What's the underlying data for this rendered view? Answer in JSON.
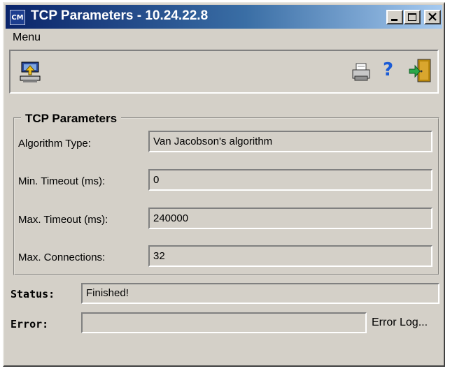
{
  "window": {
    "title": "TCP Parameters - 10.24.22.8",
    "app_icon_text": "CM",
    "controls": [
      "minimize",
      "maximize",
      "close"
    ]
  },
  "menu": {
    "items": [
      "Menu"
    ]
  },
  "toolbar": {
    "left_icon": "upload-to-device-icon",
    "right_icons": [
      "printer-icon",
      "help-icon",
      "exit-door-icon"
    ],
    "help_glyph": "?"
  },
  "tcp_parameters": {
    "group_title": "TCP Parameters",
    "fields": [
      {
        "label": "Algorithm Type:",
        "value": "Van Jacobson's algorithm"
      },
      {
        "label": "Min. Timeout (ms):",
        "value": "0"
      },
      {
        "label": "Max. Timeout (ms):",
        "value": "240000"
      },
      {
        "label": "Max. Connections:",
        "value": "32"
      }
    ]
  },
  "status": {
    "label": "Status:",
    "value": "Finished!"
  },
  "error": {
    "label": "Error:",
    "value": "",
    "log_link": "Error Log..."
  }
}
